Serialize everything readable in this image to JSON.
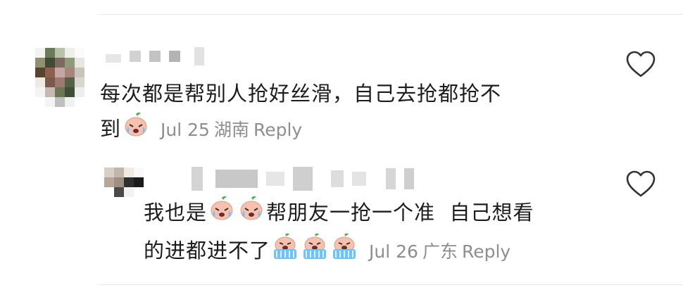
{
  "comments": [
    {
      "text_line1": "每次都是帮别人抢好丝滑，自己去抢都抢不",
      "text_line2": "到",
      "emojis_inline": [
        "crying-face-emoji"
      ],
      "date": "Jul 25",
      "location": "湖南",
      "reply_label": "Reply",
      "like_icon": "heart-outline-icon"
    },
    {
      "text_part1": "我也是",
      "emojis_mid": [
        "crying-face-emoji",
        "crying-face-emoji"
      ],
      "text_part2": "帮朋友一抢一个准  自己想看",
      "text_line2": "的进都进不了",
      "emojis_end": [
        "crying-waterfall-emoji",
        "crying-waterfall-emoji",
        "crying-waterfall-emoji"
      ],
      "date": "Jul 26",
      "location": "广东",
      "reply_label": "Reply",
      "like_icon": "heart-outline-icon"
    }
  ],
  "colors": {
    "text": "#1c1c1c",
    "meta": "#8e8e8e",
    "divider": "#e9e9e9"
  }
}
